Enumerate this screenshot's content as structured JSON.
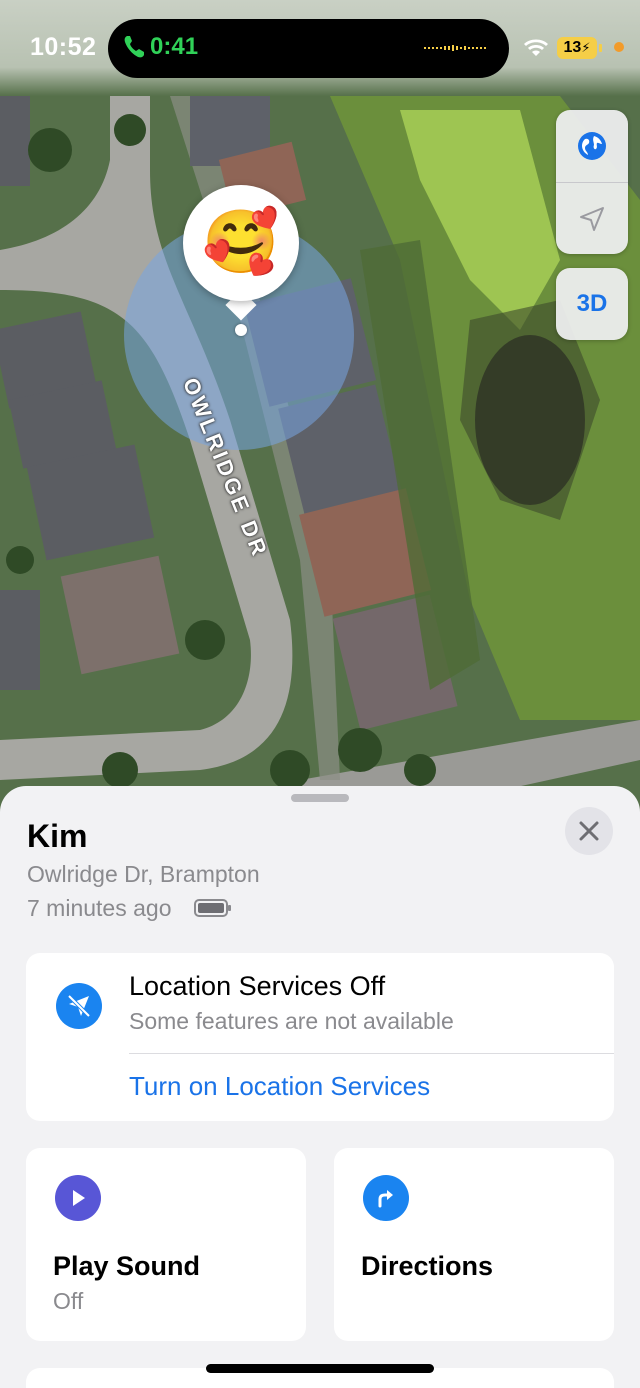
{
  "status_bar": {
    "time": "10:52",
    "call_timer": "0:41",
    "battery_level": "13",
    "battery_charging": true
  },
  "map": {
    "street_label": "OWLRIDGE DR",
    "controls": {
      "globe_icon": "globe-icon",
      "location_icon": "location-arrow-icon",
      "three_d_label": "3D"
    },
    "pin_emoji": "🥰"
  },
  "sheet": {
    "name": "Kim",
    "address": "Owlridge Dr, Brampton",
    "last_seen": "7 minutes ago",
    "location_card": {
      "title": "Location Services Off",
      "subtitle": "Some features are not available",
      "action": "Turn on Location Services"
    },
    "actions": [
      {
        "title": "Play Sound",
        "subtitle": "Off",
        "icon": "play-icon",
        "color": "#5856d6"
      },
      {
        "title": "Directions",
        "subtitle": "",
        "icon": "directions-arrow-icon",
        "color": "#1a84f0"
      }
    ]
  }
}
